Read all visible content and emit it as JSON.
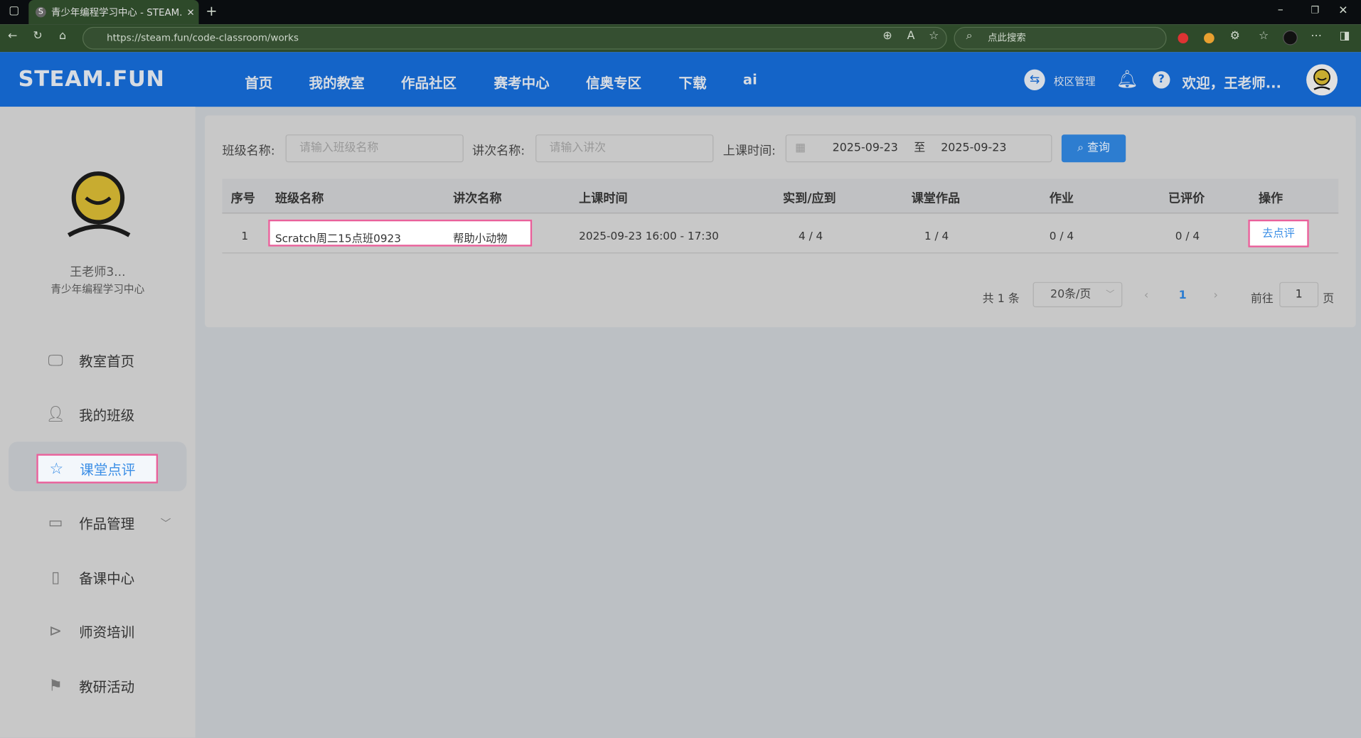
{
  "browser": {
    "tab_title": "青少年编程学习中心 - STEAM.FUN",
    "favicon": "S",
    "url": "https://steam.fun/code-classroom/works",
    "search_placeholder": "点此搜索"
  },
  "header": {
    "logo": "STEAM.FUN",
    "nav": [
      "首页",
      "我的教室",
      "作品社区",
      "赛考中心",
      "信奥专区",
      "下载",
      "ai"
    ],
    "campus": "校区管理",
    "welcome": "欢迎，王老师..."
  },
  "sidebar": {
    "user_name": "王老师3...",
    "org": "青少年编程学习中心",
    "items": [
      {
        "label": "教室首页",
        "icon": "monitor-icon"
      },
      {
        "label": "我的班级",
        "icon": "user-icon"
      },
      {
        "label": "课堂点评",
        "icon": "star-icon",
        "active": true
      },
      {
        "label": "作品管理",
        "icon": "card-icon"
      },
      {
        "label": "备课中心",
        "icon": "book-icon"
      },
      {
        "label": "师资培训",
        "icon": "play-icon"
      },
      {
        "label": "教研活动",
        "icon": "flag-icon"
      }
    ]
  },
  "filters": {
    "class_label": "班级名称:",
    "class_placeholder": "请输入班级名称",
    "lesson_label": "讲次名称:",
    "lesson_placeholder": "请输入讲次",
    "time_label": "上课时间:",
    "date_start": "2025-09-23",
    "date_sep": "至",
    "date_end": "2025-09-23",
    "query": "查询"
  },
  "table": {
    "headers": [
      "序号",
      "班级名称",
      "讲次名称",
      "上课时间",
      "实到/应到",
      "课堂作品",
      "作业",
      "已评价",
      "操作"
    ],
    "rows": [
      {
        "index": "1",
        "class": "Scratch周二15点班0923",
        "lesson": "帮助小动物",
        "time": "2025-09-23 16:00 - 17:30",
        "attend": "4 / 4",
        "works": "1 / 4",
        "homework": "0 / 4",
        "reviewed": "0 / 4",
        "action": "去点评"
      }
    ]
  },
  "pagination": {
    "total": "共 1 条",
    "page_size": "20条/页",
    "current": "1",
    "goto_label": "前往",
    "goto_value": "1",
    "page_suffix": "页"
  },
  "colors": {
    "header": "#1464c8",
    "accent": "#2d7dd0",
    "highlight": "#e8609a"
  }
}
